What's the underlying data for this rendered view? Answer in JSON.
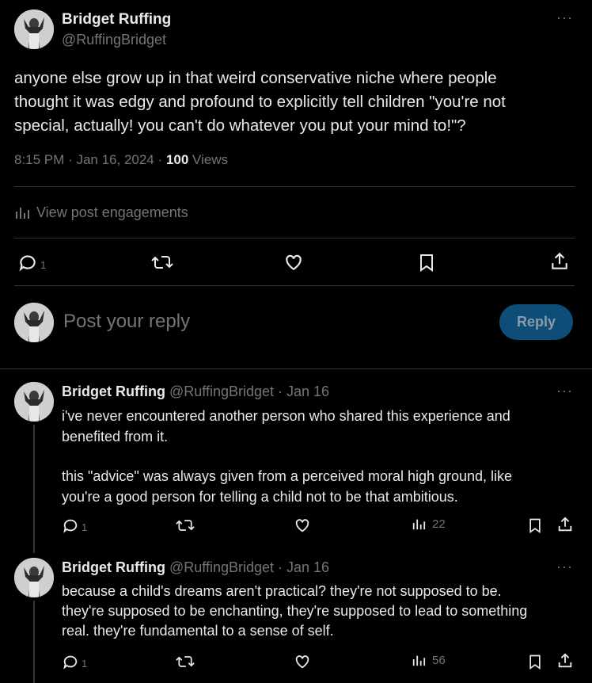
{
  "main_post": {
    "display_name": "Bridget Ruffing",
    "handle": "@RuffingBridget",
    "text_line1": "anyone else grow up in that weird conservative niche where people",
    "text_line2": "thought it was edgy and profound to explicitly tell children \"you're not",
    "text_line3": "special, actually! you can't do whatever you put your mind to!\"?",
    "time": "8:15 PM",
    "sep1": "·",
    "date": "Jan 16, 2024",
    "sep2": "·",
    "views_count": "100",
    "views_label": "Views",
    "engagements_label": "View post engagements",
    "reply_count": "1"
  },
  "composer": {
    "placeholder": "Post your reply",
    "reply_button": "Reply"
  },
  "replies": [
    {
      "display_name": "Bridget Ruffing",
      "handle_date": "@RuffingBridget · Jan 16",
      "line1": "i've never encountered another person who shared this experience and",
      "line2": "benefited from it.",
      "line3": "this \"advice\" was always given from a perceived moral high ground, like",
      "line4": "you're a good person for telling a child not to be that ambitious.",
      "reply_count": "1",
      "views": "22"
    },
    {
      "display_name": "Bridget Ruffing",
      "handle_date": "@RuffingBridget · Jan 16",
      "line1": "because a child's dreams aren't practical? they're not supposed to be.",
      "line2": "they're supposed to be enchanting, they're supposed to lead to something",
      "line3": "real. they're fundamental to a sense of self.",
      "reply_count": "1",
      "views": "56"
    }
  ],
  "more_label": "···",
  "colors": {
    "background": "#000000",
    "text": "#e7e9ea",
    "muted": "#71767b",
    "divider": "#2f3336",
    "reply_button": "#1d9bf0"
  },
  "icons": [
    "more-icon",
    "reply-icon",
    "retweet-icon",
    "like-icon",
    "bookmark-icon",
    "share-icon",
    "analytics-icon"
  ]
}
